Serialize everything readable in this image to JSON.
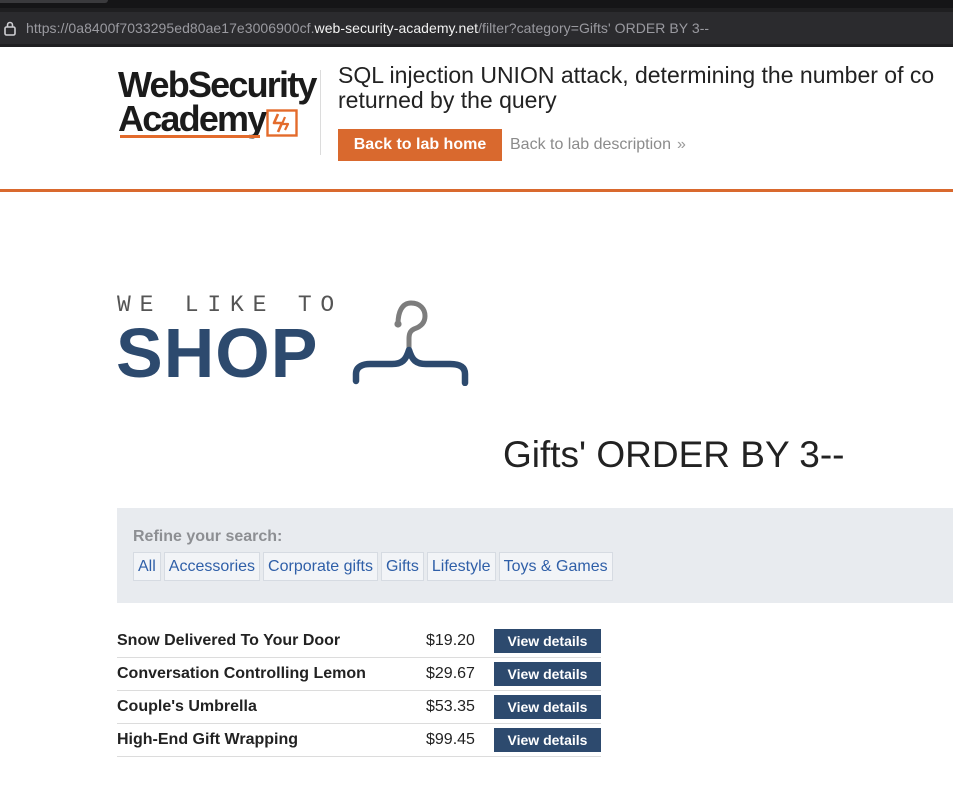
{
  "browser": {
    "url_prefix": "https://0a8400f7033295ed80ae17e3006900cf.",
    "url_host": "web-security-academy.net",
    "url_path": "/filter?category=Gifts' ORDER BY 3--",
    "lock_icon": "lock-icon"
  },
  "academy": {
    "logo_line1": "WebSecurity",
    "logo_line2": "Academy",
    "lab_title_line1": "SQL injection UNION attack, determining the number of co",
    "lab_title_line2": "returned by the query",
    "back_to_lab_home": "Back to lab home",
    "back_to_lab_description": "Back to lab description",
    "chevron": "»",
    "accent_color": "#d9692e"
  },
  "shop": {
    "tagline": "WE LIKE TO",
    "wordmark": "SHOP",
    "logo_icon": "hanger-icon",
    "brand_color": "#2d4a6e"
  },
  "category_title": "Gifts' ORDER BY 3--",
  "filters": {
    "label": "Refine your search:",
    "options": [
      "All",
      "Accessories",
      "Corporate gifts",
      "Gifts",
      "Lifestyle",
      "Toys & Games"
    ]
  },
  "products": [
    {
      "name": "Snow Delivered To Your Door",
      "price": "$19.20",
      "action": "View details"
    },
    {
      "name": "Conversation Controlling Lemon",
      "price": "$29.67",
      "action": "View details"
    },
    {
      "name": "Couple's Umbrella",
      "price": "$53.35",
      "action": "View details"
    },
    {
      "name": "High-End Gift Wrapping",
      "price": "$99.45",
      "action": "View details"
    }
  ]
}
